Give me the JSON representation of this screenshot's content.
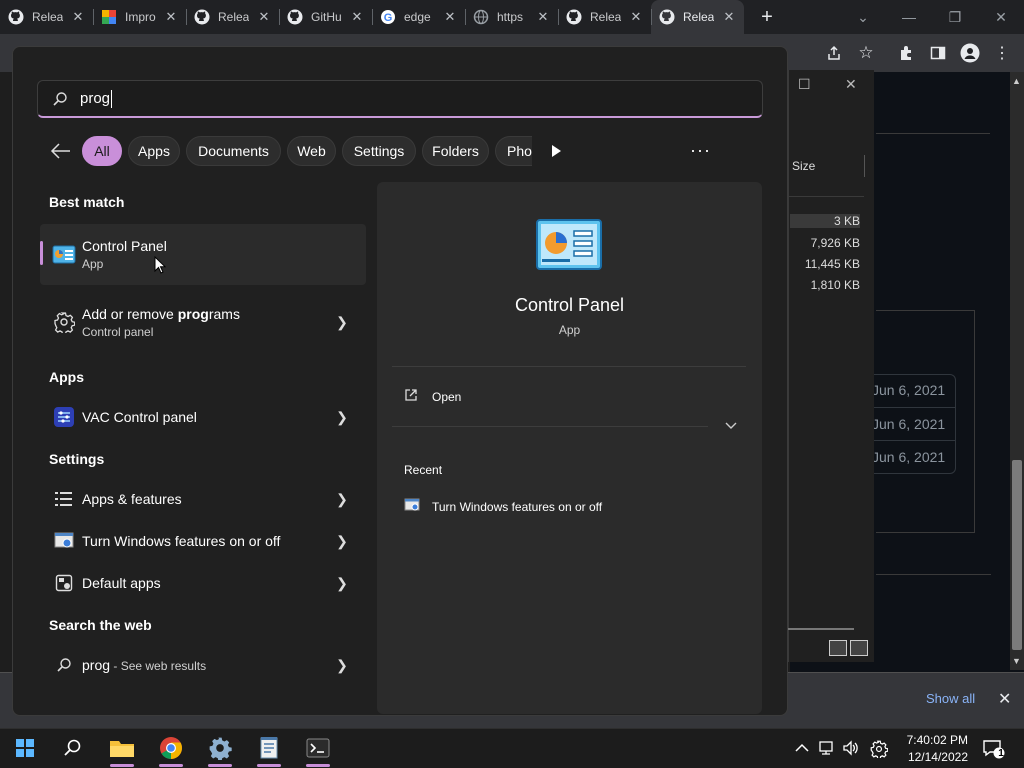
{
  "browser": {
    "tabs": [
      {
        "label": "Relea",
        "icon": "github-icon"
      },
      {
        "label": "Impro",
        "icon": "app-icon"
      },
      {
        "label": "Relea",
        "icon": "github-icon"
      },
      {
        "label": "GitHu",
        "icon": "github-icon"
      },
      {
        "label": "edge",
        "icon": "google-icon"
      },
      {
        "label": "https",
        "icon": "globe-icon"
      },
      {
        "label": "Relea",
        "icon": "github-icon"
      },
      {
        "label": "Relea",
        "icon": "github-icon",
        "active": true
      }
    ],
    "new_tab": "+",
    "downloads": {
      "show_all": "Show all",
      "close": "✕"
    }
  },
  "background_window": {
    "size_header": "Size",
    "sizes": [
      "3 KB",
      "7,926 KB",
      "11,445 KB",
      "1,810 KB"
    ],
    "dates": [
      "Jun 6, 2021",
      "Jun 6, 2021",
      "Jun 6, 2021"
    ]
  },
  "search": {
    "query": "prog",
    "filters": [
      {
        "label": "All",
        "active": true
      },
      {
        "label": "Apps"
      },
      {
        "label": "Documents"
      },
      {
        "label": "Web"
      },
      {
        "label": "Settings"
      },
      {
        "label": "Folders"
      },
      {
        "label": "Phot"
      }
    ],
    "more": "···"
  },
  "results": {
    "best_match_heading": "Best match",
    "best_match": {
      "title": "Control Panel",
      "subtitle": "App"
    },
    "add_remove": {
      "title_prefix": "Add or remove ",
      "title_match": "prog",
      "title_suffix": "rams",
      "subtitle": "Control panel"
    },
    "apps_heading": "Apps",
    "apps": [
      {
        "title": "VAC Control panel"
      }
    ],
    "settings_heading": "Settings",
    "settings": [
      {
        "title": "Apps & features"
      },
      {
        "title": "Turn Windows features on or off"
      },
      {
        "title": "Default apps"
      }
    ],
    "web_heading": "Search the web",
    "web": {
      "query": "prog",
      "suffix": " - See web results"
    }
  },
  "detail": {
    "title": "Control Panel",
    "subtitle": "App",
    "open_label": "Open",
    "recent_heading": "Recent",
    "recent_items": [
      "Turn Windows features on or off"
    ]
  },
  "taskbar": {
    "time": "7:40:02 PM",
    "date": "12/14/2022",
    "notifications": "1"
  },
  "colors": {
    "accent": "#c98fd9",
    "panel": "#202020",
    "detail": "#2b2b2b"
  }
}
